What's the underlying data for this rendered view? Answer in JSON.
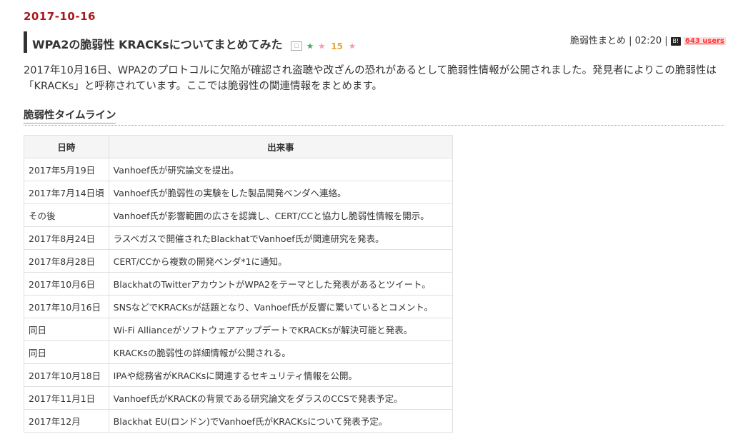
{
  "entry": {
    "date": "2017-10-16",
    "title": "WPA2の脆弱性 KRACKsについてまとめてみた",
    "star_count": "15",
    "category": "脆弱性まとめ",
    "time": "02:20",
    "bookmark_users": "643 users",
    "intro": "2017年10月16日、WPA2のプロトコルに欠陥が確認され盗聴や改ざんの恐れがあるとして脆弱性情報が公開されました。発見者によりこの脆弱性は「KRACKs」と呼称されています。ここでは脆弱性の関連情報をまとめます。"
  },
  "section": {
    "title": "脆弱性タイムライン"
  },
  "timeline": {
    "headers": [
      "日時",
      "出来事"
    ],
    "rows": [
      {
        "date": "2017年5月19日",
        "event": "Vanhoef氏が研究論文を提出。"
      },
      {
        "date": "2017年7月14日頃",
        "event": "Vanhoef氏が脆弱性の実験をした製品開発ベンダへ連絡。"
      },
      {
        "date": "その後",
        "event": "Vanhoef氏が影響範囲の広さを認識し、CERT/CCと協力し脆弱性情報を開示。"
      },
      {
        "date": "2017年8月24日",
        "event": "ラスベガスで開催されたBlackhatでVanhoef氏が関連研究を発表。"
      },
      {
        "date": "2017年8月28日",
        "event": "CERT/CCから複数の開発ベンダ*1に通知。"
      },
      {
        "date": "2017年10月6日",
        "event": "BlackhatのTwitterアカウントがWPA2をテーマとした発表があるとツイート。"
      },
      {
        "date": "2017年10月16日",
        "event": "SNSなどでKRACKsが話題となり、Vanhoef氏が反響に驚いているとコメント。"
      },
      {
        "date": "同日",
        "event": "Wi-Fi AllianceがソフトウェアアップデートでKRACKsが解決可能と発表。"
      },
      {
        "date": "同日",
        "event": "KRACKsの脆弱性の詳細情報が公開される。"
      },
      {
        "date": "2017年10月18日",
        "event": "IPAや総務省がKRACKsに関連するセキュリティ情報を公開。"
      },
      {
        "date": "2017年11月1日",
        "event": "Vanhoef氏がKRACKの背景である研究論文をダラスのCCSで発表予定。"
      },
      {
        "date": "2017年12月",
        "event": "Blackhat EU(ロンドン)でVanhoef氏がKRACKsについて発表予定。"
      }
    ]
  }
}
